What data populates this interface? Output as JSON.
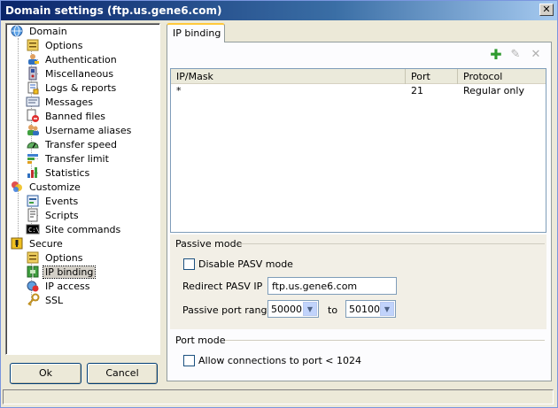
{
  "window": {
    "title": "Domain settings (ftp.us.gene6.com)"
  },
  "tree": {
    "domain": "Domain",
    "domain_children": [
      "Options",
      "Authentication",
      "Miscellaneous",
      "Logs & reports",
      "Messages",
      "Banned files",
      "Username aliases",
      "Transfer speed",
      "Transfer limit",
      "Statistics"
    ],
    "customize": "Customize",
    "customize_children": [
      "Events",
      "Scripts",
      "Site commands"
    ],
    "secure": "Secure",
    "secure_children": [
      "Options",
      "IP binding",
      "IP access",
      "SSL"
    ],
    "selected": "IP binding"
  },
  "buttons": {
    "ok": "Ok",
    "cancel": "Cancel"
  },
  "tab": {
    "label": "IP binding"
  },
  "toolbar": {
    "add_color": "#2f9a2f"
  },
  "table": {
    "columns": [
      "IP/Mask",
      "Port",
      "Protocol"
    ],
    "rows": [
      {
        "ip": "*",
        "port": "21",
        "protocol": "Regular only"
      }
    ]
  },
  "passive": {
    "title": "Passive mode",
    "disable_label": "Disable PASV mode",
    "disable_checked": false,
    "redirect_label": "Redirect PASV IP",
    "redirect_value": "ftp.us.gene6.com",
    "range_label": "Passive port range",
    "range_from": "50000",
    "range_to_label": "to",
    "range_to": "50100"
  },
  "port_mode": {
    "title": "Port mode",
    "allow_label": "Allow connections to port < 1024",
    "allow_checked": false
  }
}
